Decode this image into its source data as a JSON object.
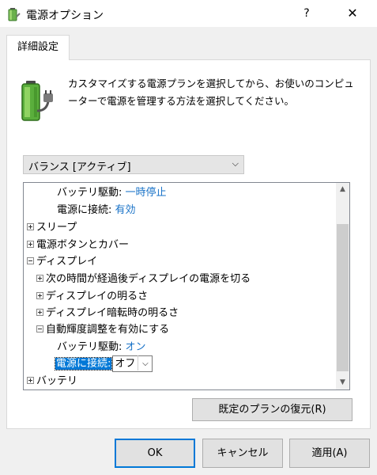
{
  "window": {
    "title": "電源オプション",
    "help_label": "?",
    "close_label": "✕"
  },
  "tab": {
    "label": "詳細設定"
  },
  "description": "カスタマイズする電源プランを選択してから、お使いのコンピューターで電源を管理する方法を選択してください。",
  "plan_select": {
    "value": "バランス [アクティブ]",
    "chevron": "⌵"
  },
  "tree": {
    "items": [
      {
        "label": "バッテリ駆動:",
        "value": "一時停止"
      },
      {
        "label": "電源に接続:",
        "value": "有効"
      },
      {
        "label": "スリープ"
      },
      {
        "label": "電源ボタンとカバー"
      },
      {
        "label": "ディスプレイ"
      },
      {
        "label": "次の時間が経過後ディスプレイの電源を切る"
      },
      {
        "label": "ディスプレイの明るさ"
      },
      {
        "label": "ディスプレイ暗転時の明るさ"
      },
      {
        "label": "自動輝度調整を有効にする"
      },
      {
        "label": "バッテリ駆動:",
        "value": "オン"
      },
      {
        "label": "電源に接続:",
        "value": "オフ"
      },
      {
        "label": "バッテリ"
      }
    ],
    "mini_chevron": "⌵",
    "scroll_up": "▲",
    "scroll_down": "▼"
  },
  "buttons": {
    "restore": "既定のプランの復元(R)",
    "ok": "OK",
    "cancel": "キャンセル",
    "apply": "適用(A)"
  },
  "colors": {
    "accent": "#0078d7",
    "value_link": "#1a73c8"
  },
  "icons": [
    "power-options-icon",
    "battery-plug-icon",
    "plus-expander-icon",
    "minus-expander-icon",
    "chevron-down-icon"
  ]
}
